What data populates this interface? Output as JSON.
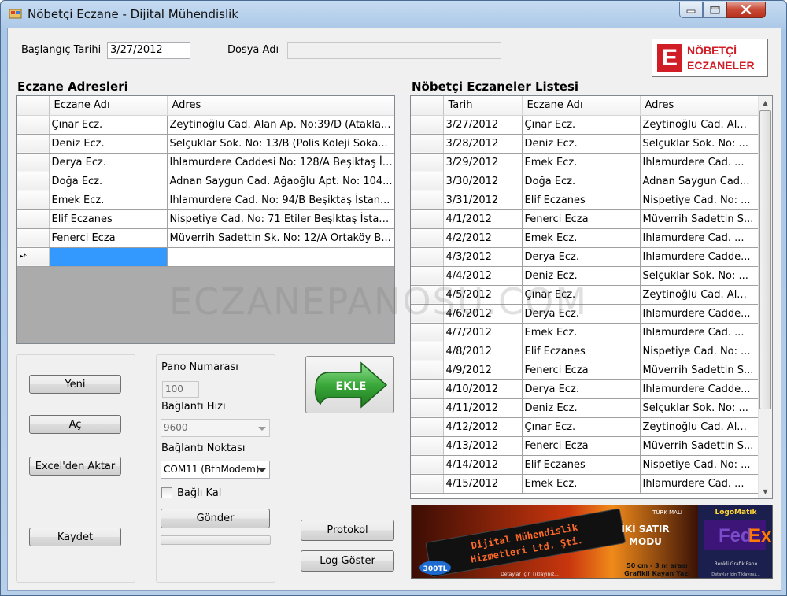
{
  "window": {
    "title": "Nöbetçi Eczane - Dijital Mühendislik"
  },
  "form": {
    "start_date_label": "Başlangıç Tarihi",
    "start_date_value": "3/27/2012",
    "file_name_label": "Dosya Adı",
    "file_name_value": ""
  },
  "logo": {
    "letter": "E",
    "line1": "NÖBETÇİ",
    "line2": "ECZANELER"
  },
  "pharmacies": {
    "title": "Eczane Adresleri",
    "columns": [
      "Eczane Adı",
      "Adres"
    ],
    "rows": [
      [
        "Çınar Ecz.",
        " Zeytinoğlu Cad. Alan Ap. No:39/D (Atakla..."
      ],
      [
        "Deniz Ecz.",
        "Selçuklar Sok. No: 13/B (Polis Koleji Soka..."
      ],
      [
        "Derya Ecz.",
        "Ihlamurdere Caddesi No: 128/A Beşiktaş İs..."
      ],
      [
        "Doğa Ecz.",
        "Adnan Saygun Cad. Ağaoğlu Apt. No: 104..."
      ],
      [
        "Emek Ecz.",
        " Ihlamurdere Cad. No: 94/B Beşiktaş İstan..."
      ],
      [
        "Elif Eczanes",
        "Nispetiye Cad. No: 71 Etiler Beşiktaş İstan..."
      ],
      [
        "Fenerci Ecza",
        "Müverrih Sadettin Sk. No: 12/A Ortaköy B..."
      ]
    ],
    "new_row_marker": "▸*"
  },
  "duty_list": {
    "title": "Nöbetçi Eczaneler Listesi",
    "columns": [
      "Tarih",
      "Eczane Adı",
      "Adres"
    ],
    "rows": [
      [
        "3/27/2012",
        "Çınar Ecz.",
        " Zeytinoğlu Cad. Al..."
      ],
      [
        "3/28/2012",
        "Deniz Ecz.",
        "Selçuklar Sok. No: ..."
      ],
      [
        "3/29/2012",
        "Emek Ecz.",
        " Ihlamurdere Cad. ..."
      ],
      [
        "3/30/2012",
        "Doğa Ecz.",
        "Adnan Saygun Cad..."
      ],
      [
        "3/31/2012",
        "Elif Eczanes",
        "Nispetiye Cad. No: ..."
      ],
      [
        "4/1/2012",
        "Fenerci Ecza",
        "Müverrih Sadettin S..."
      ],
      [
        "4/2/2012",
        "Emek Ecz.",
        " Ihlamurdere Cad. ..."
      ],
      [
        "4/3/2012",
        "Derya Ecz.",
        "Ihlamurdere Cadde..."
      ],
      [
        "4/4/2012",
        "Deniz Ecz.",
        "Selçuklar Sok. No: ..."
      ],
      [
        "4/5/2012",
        "Çınar Ecz.",
        " Zeytinoğlu Cad. Al..."
      ],
      [
        "4/6/2012",
        "Derya Ecz.",
        "Ihlamurdere Cadde..."
      ],
      [
        "4/7/2012",
        "Emek Ecz.",
        " Ihlamurdere Cad. ..."
      ],
      [
        "4/8/2012",
        "Elif Eczanes",
        "Nispetiye Cad. No: ..."
      ],
      [
        "4/9/2012",
        "Fenerci Ecza",
        "Müverrih Sadettin S..."
      ],
      [
        "4/10/2012",
        "Derya Ecz.",
        "Ihlamurdere Cadde..."
      ],
      [
        "4/11/2012",
        "Deniz Ecz.",
        "Selçuklar Sok. No: ..."
      ],
      [
        "4/12/2012",
        "Çınar Ecz.",
        " Zeytinoğlu Cad. Al..."
      ],
      [
        "4/13/2012",
        "Fenerci Ecza",
        "Müverrih Sadettin S..."
      ],
      [
        "4/14/2012",
        "Elif Eczanes",
        "Nispetiye Cad. No: ..."
      ],
      [
        "4/15/2012",
        "Emek Ecz.",
        " Ihlamurdere Cad. ..."
      ]
    ]
  },
  "buttons": {
    "new": "Yeni",
    "open": "Aç",
    "import_excel": "Excel'den Aktar",
    "save": "Kaydet",
    "add": "EKLE",
    "send": "Gönder",
    "protocol": "Protokol",
    "show_log": "Log Göster"
  },
  "board": {
    "panel_number_label": "Pano Numarası",
    "panel_number_value": "100",
    "baud_label": "Bağlantı Hızı",
    "baud_value": "9600",
    "port_label": "Bağlantı Noktası",
    "port_value": "COM11 (BthModem)",
    "stay_connected_label": "Bağlı Kal"
  },
  "banner": {
    "led_line1": "Dijital Mühendislik",
    "led_line2": "Hizmetleri Ltd. Şti.",
    "price_badge": "300TL",
    "title1": "İKİ SATIR",
    "title2": "MODU",
    "size_text": "50 cm - 3 m arası",
    "sub_text": "Grafikli Kayan Yazı",
    "details_text": "Detaylar İçin Tıklayınız...",
    "brand_tag": "TÜRK MALI",
    "side_logo": "LogoMatik",
    "side_caption": "Renkli Grafik Pano",
    "side_details": "Detaylar İçin Tıklayınız..."
  },
  "watermark": "ECZANEPANOSU.COM",
  "colors": {
    "selection": "#3399ff",
    "logo_red": "#d11d26",
    "ekle_green": "#3aa83a"
  }
}
